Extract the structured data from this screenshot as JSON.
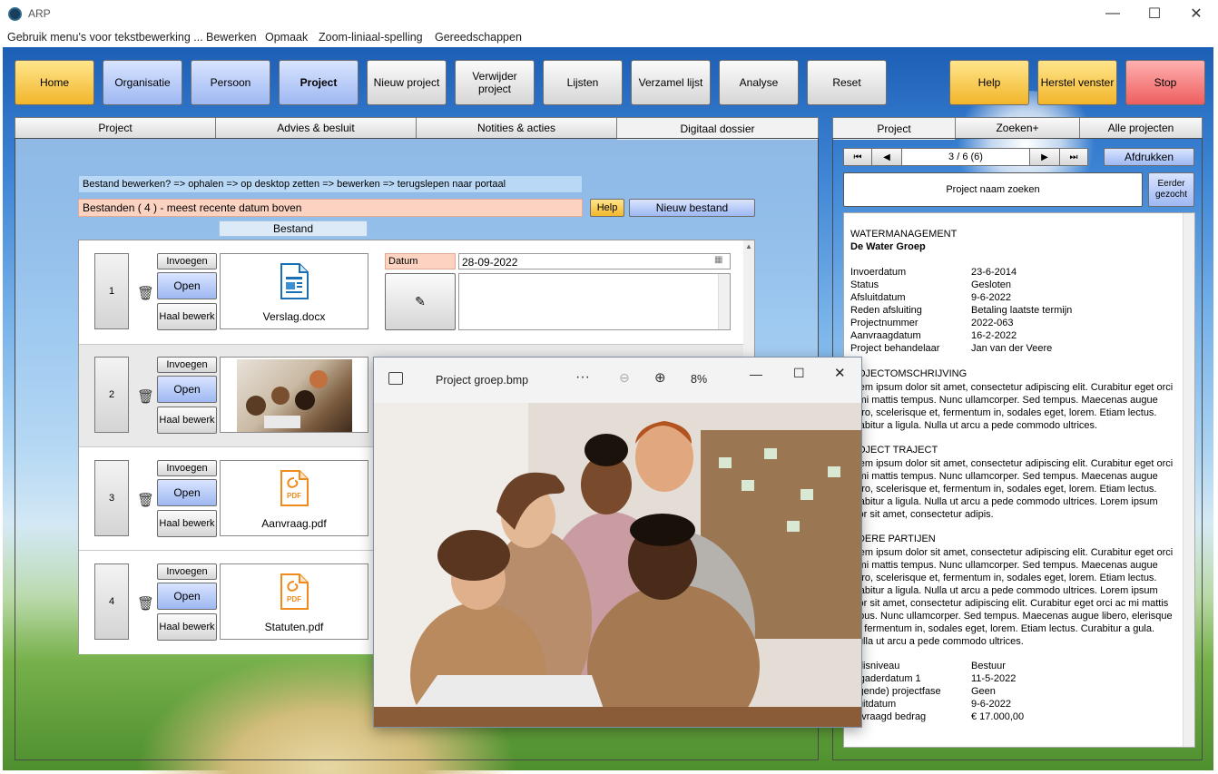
{
  "window": {
    "title": "ARP",
    "minimize": "—",
    "maximize": "☐",
    "close": "✕"
  },
  "menu": [
    "Gebruik menu's voor tekstbewerking ...",
    "Bewerken",
    "Opmaak",
    "Zoom-liniaal-spelling",
    "Gereedschappen"
  ],
  "toolbar": {
    "home": "Home",
    "organisatie": "Organisatie",
    "persoon": "Persoon",
    "project": "Project",
    "nieuw_project": "Nieuw project",
    "verwijder_project": "Verwijder project",
    "lijsten": "Lijsten",
    "verzamel_lijst": "Verzamel lijst",
    "analyse": "Analyse",
    "reset": "Reset",
    "help": "Help",
    "herstel_venster": "Herstel venster",
    "stop": "Stop"
  },
  "left_tabs": [
    "Project",
    "Advies & besluit",
    "Notities & acties",
    "Digitaal dossier"
  ],
  "dossier": {
    "instruction": "Bestand bewerken? => ophalen => op desktop zetten => bewerken => terugslepen naar portaal",
    "count_text": "Bestanden ( 4 )  -  meest recente datum boven",
    "help": "Help",
    "new_file": "Nieuw bestand",
    "column_header": "Bestand",
    "insert": "Invoegen",
    "open": "Open",
    "fetch_edit": "Haal bewerk",
    "datum_label": "Datum",
    "datum_value": "28-09-2022",
    "files": [
      {
        "num": "1",
        "name": "Verslag.docx",
        "icon": "document-icon"
      },
      {
        "num": "2",
        "name": "",
        "icon": "photo-thumbnail"
      },
      {
        "num": "3",
        "name": "Aanvraag.pdf",
        "icon": "pdf-icon"
      },
      {
        "num": "4",
        "name": "Statuten.pdf",
        "icon": "pdf-icon"
      }
    ],
    "pdf_label": "PDF"
  },
  "right_tabs": [
    "Project",
    "Zoeken+",
    "Alle projecten"
  ],
  "nav": {
    "first": "⏮",
    "prev": "◀",
    "position": "3 / 6 (6)",
    "next": "▶",
    "last": "⏭",
    "print": "Afdrukken"
  },
  "search": {
    "label": "Project naam zoeken",
    "earlier": "Eerder gezocht"
  },
  "detail": {
    "category": "WATERMANAGEMENT",
    "organisation": "De Water Groep",
    "fields": [
      {
        "label": "Invoerdatum",
        "value": "23-6-2014"
      },
      {
        "label": "Status",
        "value": "Gesloten"
      },
      {
        "label": "Afsluitdatum",
        "value": "9-6-2022"
      },
      {
        "label": "Reden afsluiting",
        "value": "Betaling laatste termijn"
      },
      {
        "label": "Projectnummer",
        "value": "2022-063"
      },
      {
        "label": "Aanvraagdatum",
        "value": "16-2-2022"
      },
      {
        "label": "Project behandelaar",
        "value": "Jan van der Veere"
      }
    ],
    "section1_title": "ROJECTOMSCHRIJVING",
    "section1_text": "orem ipsum dolor sit amet, consectetur adipiscing elit. Curabitur eget orci c mi mattis tempus. Nunc ullamcorper. Sed tempus. Maecenas augue bero, scelerisque et, fermentum in, sodales eget, lorem. Etiam lectus. urabitur a ligula. Nulla ut arcu a pede commodo ultrices.",
    "section2_title": "ROJECT TRAJECT",
    "section2_text": "orem ipsum dolor sit amet, consectetur adipiscing elit. Curabitur eget orci c mi mattis tempus. Nunc ullamcorper. Sed tempus. Maecenas augue bero, scelerisque et, fermentum in, sodales eget, lorem. Etiam lectus. urabitur a ligula. Nulla ut arcu a pede commodo ultrices. Lorem ipsum olor sit amet, consectetur adipis.",
    "section3_title": "NDERE PARTIJEN",
    "section3_text": "orem ipsum dolor sit amet, consectetur adipiscing elit. Curabitur eget orci c mi mattis tempus. Nunc ullamcorper. Sed tempus. Maecenas augue bero, scelerisque et, fermentum in, sodales eget, lorem. Etiam lectus. urabitur a ligula. Nulla ut arcu a pede commodo ultrices. Lorem ipsum olor sit amet, consectetur adipiscing elit. Curabitur eget orci ac mi mattis mpus. Nunc ullamcorper. Sed tempus. Maecenas augue libero, elerisque et, fermentum in, sodales eget, lorem. Etiam lectus. Curabitur a gula. Nulla ut arcu a pede commodo ultrices.",
    "fields2": [
      {
        "label": "eslisniveau",
        "value": "Bestuur"
      },
      {
        "label": "ergaderdatum 1",
        "value": "11-5-2022"
      },
      {
        "label": "olgende) projectfase",
        "value": "Geen"
      },
      {
        "label": "sluitdatum",
        "value": "9-6-2022"
      },
      {
        "label": "anvraagd bedrag",
        "value": "€ 17.000,00"
      }
    ]
  },
  "viewer": {
    "title": "Project groep.bmp",
    "more": "···",
    "zoom": "8%",
    "minimize": "—",
    "maximize": "☐",
    "close": "✕"
  }
}
